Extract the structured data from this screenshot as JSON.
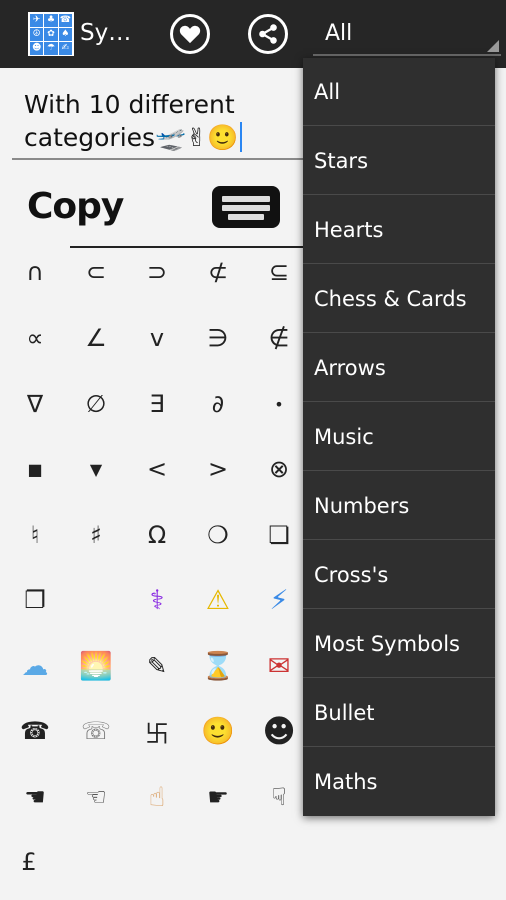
{
  "actionbar": {
    "app_title": "Sy…",
    "app_icon_cells": [
      "✈",
      "♣",
      "☎",
      "☮",
      "✿",
      "♠",
      "☻",
      "☂",
      "✍"
    ],
    "spinner_value": "All"
  },
  "editor": {
    "text_line1": "With 10 different",
    "text_line2": "categories🛫✌🙂",
    "copy_label": "Copy"
  },
  "symbols": [
    [
      "∩",
      "⊂",
      "⊃",
      "⊄",
      "⊆"
    ],
    [
      "∝",
      "∠",
      "v",
      "∋",
      "∉"
    ],
    [
      "∇",
      "∅",
      "∃",
      "∂",
      "•"
    ],
    [
      "■",
      "▼",
      "<",
      ">",
      "⊗"
    ],
    [
      "♮",
      "♯",
      "Ω",
      "❍",
      "❏"
    ],
    [
      "❐",
      "",
      "⚕",
      "⚠",
      "⚡"
    ],
    [
      "☁",
      "🌅",
      "✎",
      "⌛",
      "✉"
    ],
    [
      "☎",
      "☏",
      "卐",
      "🙂",
      "☻"
    ],
    [
      "☚",
      "☜",
      "☝",
      "☛",
      "☟"
    ],
    [
      "£",
      "",
      "",
      "",
      ""
    ]
  ],
  "dropdown": {
    "items": [
      "All",
      "Stars",
      "Hearts",
      "Chess & Cards",
      "Arrows",
      "Music",
      "Numbers",
      "Cross's",
      "Most Symbols",
      "Bullet",
      "Maths"
    ]
  }
}
